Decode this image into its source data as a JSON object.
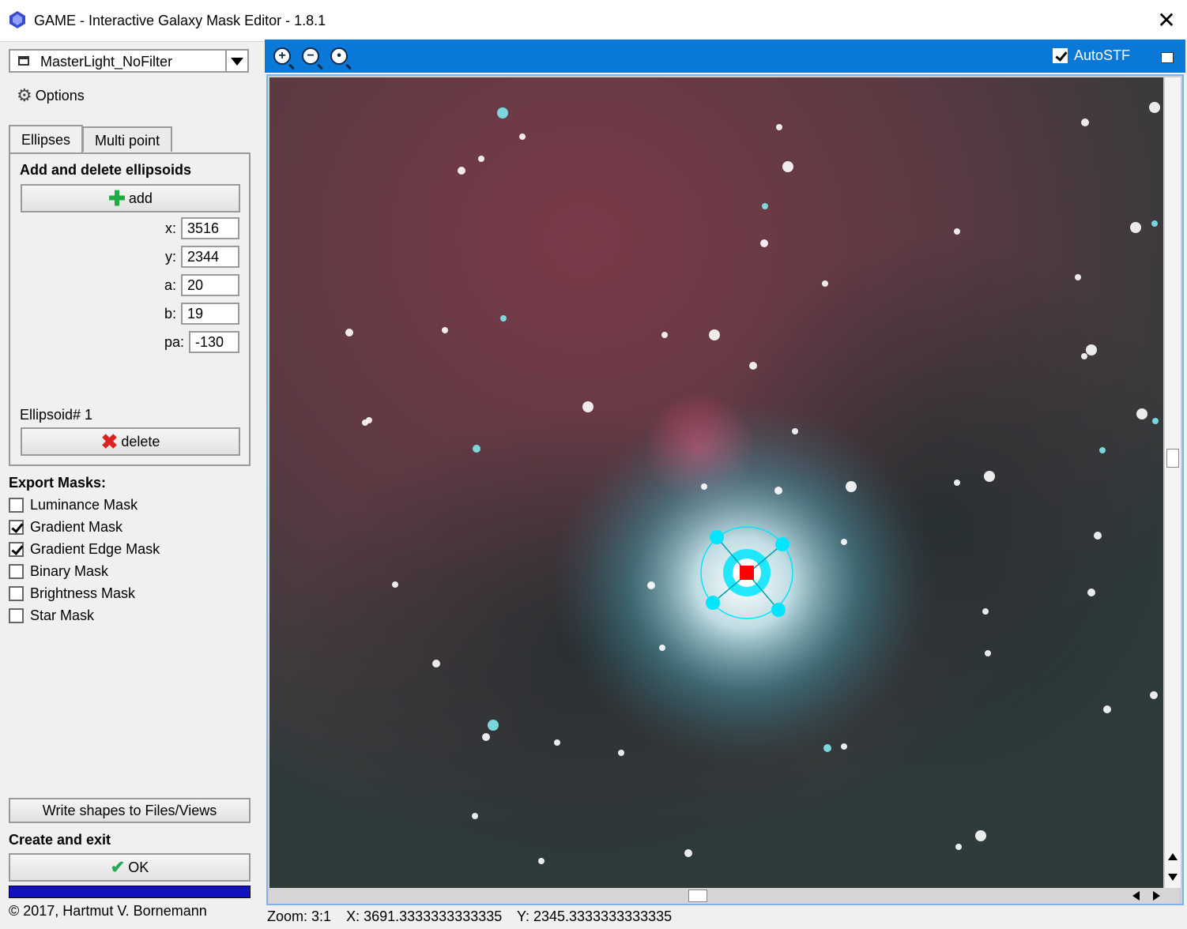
{
  "window": {
    "title": "GAME - Interactive Galaxy Mask Editor -  1.8.1"
  },
  "view_selector": {
    "value": "MasterLight_NoFilter"
  },
  "options_label": "Options",
  "tabs": [
    {
      "label": "Ellipses",
      "active": true
    },
    {
      "label": "Multi point",
      "active": false
    }
  ],
  "ellipses_panel": {
    "title": "Add and delete ellipsoids",
    "add_label": "add",
    "fields": {
      "x": {
        "label": "x:",
        "value": "3516"
      },
      "y": {
        "label": "y:",
        "value": "2344"
      },
      "a": {
        "label": "a:",
        "value": "20"
      },
      "b": {
        "label": "b:",
        "value": "19"
      },
      "pa": {
        "label": "pa:",
        "value": "-130"
      }
    },
    "ellipsoid_label": "Ellipsoid# 1",
    "delete_label": "delete"
  },
  "export": {
    "title": "Export Masks:",
    "items": [
      {
        "label": "Luminance Mask",
        "checked": false
      },
      {
        "label": "Gradient Mask",
        "checked": true
      },
      {
        "label": "Gradient Edge Mask",
        "checked": true
      },
      {
        "label": "Binary Mask",
        "checked": false
      },
      {
        "label": "Brightness Mask",
        "checked": false
      },
      {
        "label": "Star Mask",
        "checked": false
      }
    ]
  },
  "write_shapes_label": "Write shapes to Files/Views",
  "create_title": "Create and exit",
  "ok_label": "OK",
  "progress": 1.0,
  "copyright": "© 2017, Hartmut V. Bornemann",
  "viewer": {
    "autostf_label": "AutoSTF",
    "autostf_checked": true
  },
  "status": {
    "zoom": "Zoom: 3:1",
    "x": "X: 3691.3333333333335",
    "y": "Y: 2345.3333333333335"
  },
  "colors": {
    "toolbar": "#0a78d7",
    "progress": "#1010c0",
    "ellipse_handle": "#00e5ff",
    "center_marker": "#ff0000"
  }
}
